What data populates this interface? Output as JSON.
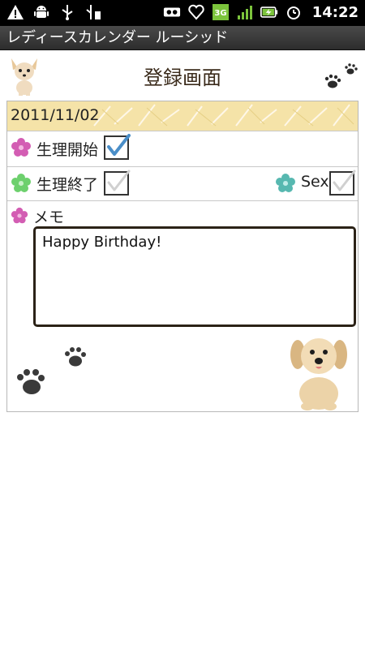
{
  "status_bar": {
    "time": "14:22",
    "network": "3G",
    "left_icons": [
      "warning-icon",
      "android-icon",
      "usb-icon",
      "usb-debug-icon"
    ],
    "right_icons": [
      "voicemail-icon",
      "heart-sync-icon",
      "network-3g-icon",
      "signal-icon",
      "battery-charging-icon",
      "alarm-icon"
    ]
  },
  "app": {
    "title": "レディースカレンダー ルーシッド"
  },
  "screen": {
    "title": "登録画面"
  },
  "form": {
    "date": "2011/11/02",
    "period_start": {
      "label": "生理開始",
      "checked": true
    },
    "period_end": {
      "label": "生理終了",
      "checked": false
    },
    "sex": {
      "label": "Sex",
      "checked": false
    },
    "memo": {
      "label": "メモ",
      "value": "Happy Birthday!"
    }
  },
  "colors": {
    "flower_pink": "#d35db3",
    "flower_green": "#6dd06d",
    "flower_teal": "#57b8b0",
    "date_row_bg": "#f5e3a8",
    "check_mark": "#4a8ec8"
  }
}
